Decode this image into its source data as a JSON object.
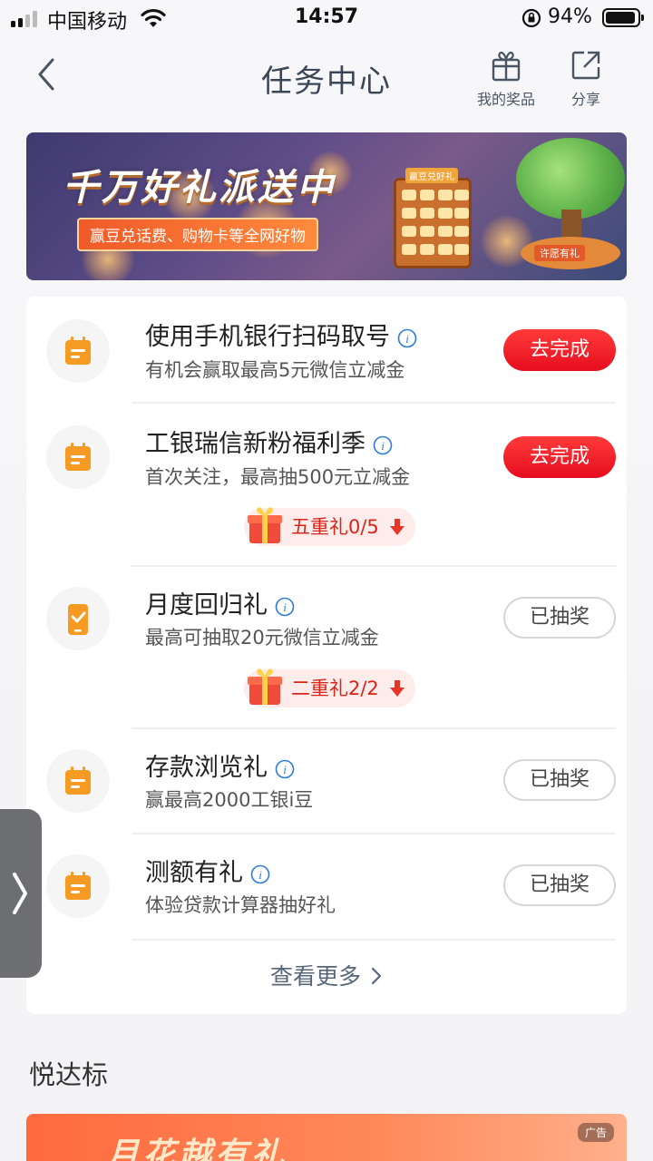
{
  "status_bar": {
    "carrier": "中国移动",
    "time": "14:57",
    "battery_pct": "94%",
    "battery_level": 0.94
  },
  "header": {
    "title": "任务中心",
    "prizes_label": "我的奖品",
    "share_label": "分享"
  },
  "banner": {
    "title": "千万好礼派送中",
    "subtitle": "赢豆兑话费、购物卡等全网好物",
    "board_tag": "赢豆兑好礼",
    "tree_sign": "许愿有礼"
  },
  "tasks": [
    {
      "title": "使用手机银行扫码取号",
      "desc": "有机会赢取最高5元微信立减金",
      "action": "去完成",
      "icon": "calendar-icon"
    },
    {
      "title": "工银瑞信新粉福利季",
      "desc": "首次关注，最高抽500元立减金",
      "action": "去完成",
      "icon": "calendar-icon",
      "gift": "五重礼0/5"
    },
    {
      "title": "月度回归礼",
      "desc": "最高可抽取20元微信立减金",
      "action": "已抽奖",
      "icon": "phone-check-icon",
      "gift": "二重礼2/2"
    },
    {
      "title": "存款浏览礼",
      "desc": "赢最高2000工银i豆",
      "action": "已抽奖",
      "icon": "calendar-icon"
    },
    {
      "title": "测额有礼",
      "desc": "体验贷款计算器抽好礼",
      "action": "已抽奖",
      "icon": "calendar-icon"
    }
  ],
  "more_label": "查看更多",
  "section": {
    "title": "悦达标"
  },
  "ad": {
    "text": "月花越有礼",
    "tag": "广告"
  },
  "colors": {
    "accent_red": "#e60d1f",
    "icon_orange": "#f59a23",
    "title_gray": "#3b4656"
  }
}
